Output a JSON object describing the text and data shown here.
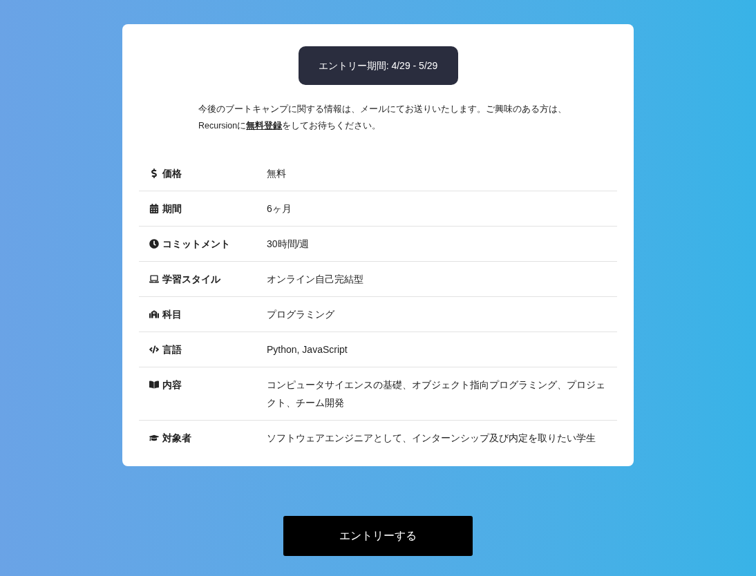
{
  "entry_period": {
    "label": "エントリー期間: 4/29 - 5/29"
  },
  "notice": {
    "line_1": "今後のブートキャンプに関する情報は、メールにてお送りいたします。ご興味のある方は、",
    "line_2_start": "Recursionに",
    "link": "無料登録",
    "line_2_end": "をしてお待ちください。"
  },
  "details": [
    {
      "kind": "price",
      "label": "価格",
      "value": "無料"
    },
    {
      "kind": "duration",
      "label": "期間",
      "value": "6ヶ月"
    },
    {
      "kind": "commitment",
      "label": "コミットメント",
      "value": "30時間/週"
    },
    {
      "kind": "style",
      "label": "学習スタイル",
      "value": "オンライン自己完結型"
    },
    {
      "kind": "subject",
      "label": "科目",
      "value": "プログラミング"
    },
    {
      "kind": "language",
      "label": "言語",
      "value": "Python, JavaScript"
    },
    {
      "kind": "content",
      "label": "内容",
      "value": "コンピュータサイエンスの基礎、オブジェクト指向プログラミング、プロジェクト、チーム開発"
    },
    {
      "kind": "audience",
      "label": "対象者",
      "value": "ソフトウェアエンジニアとして、インターンシップ及び内定を取りたい学生"
    }
  ],
  "entry_button": {
    "label": "エントリーする"
  }
}
